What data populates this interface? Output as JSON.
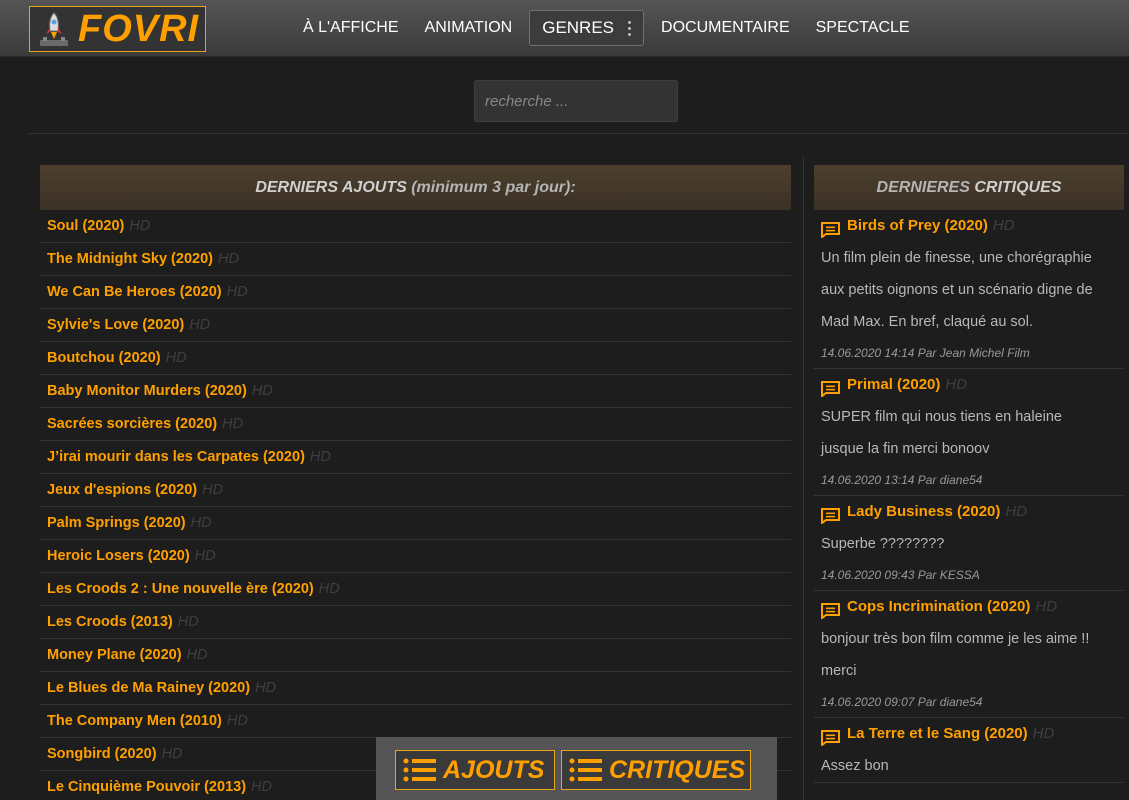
{
  "header": {
    "logo_text": "FOVRI",
    "nav": [
      {
        "label": "À L'AFFICHE"
      },
      {
        "label": "ANIMATION"
      },
      {
        "label": "GENRES"
      },
      {
        "label": "DOCUMENTAIRE"
      },
      {
        "label": "SPECTACLE"
      }
    ]
  },
  "search": {
    "placeholder": "recherche ..."
  },
  "latest": {
    "title_em": "DERNIERS AJOUTS",
    "title_rest": " (minimum 3 par jour):",
    "items": [
      {
        "title": "Soul (2020)",
        "quality": "HD"
      },
      {
        "title": "The Midnight Sky (2020)",
        "quality": "HD"
      },
      {
        "title": "We Can Be Heroes (2020)",
        "quality": "HD"
      },
      {
        "title": "Sylvie's Love (2020)",
        "quality": "HD"
      },
      {
        "title": "Boutchou (2020)",
        "quality": "HD"
      },
      {
        "title": "Baby Monitor Murders (2020)",
        "quality": "HD"
      },
      {
        "title": "Sacrées sorcières (2020)",
        "quality": "HD"
      },
      {
        "title": "J’irai mourir dans les Carpates (2020)",
        "quality": "HD"
      },
      {
        "title": "Jeux d'espions (2020)",
        "quality": "HD"
      },
      {
        "title": "Palm Springs (2020)",
        "quality": "HD"
      },
      {
        "title": "Heroic Losers (2020)",
        "quality": "HD"
      },
      {
        "title": "Les Croods 2 : Une nouvelle ère (2020)",
        "quality": "HD"
      },
      {
        "title": "Les Croods (2013)",
        "quality": "HD"
      },
      {
        "title": "Money Plane (2020)",
        "quality": "HD"
      },
      {
        "title": "Le Blues de Ma Rainey (2020)",
        "quality": "HD"
      },
      {
        "title": "The Company Men (2010)",
        "quality": "HD"
      },
      {
        "title": "Songbird (2020)",
        "quality": "HD"
      },
      {
        "title": "Le Cinquième Pouvoir (2013)",
        "quality": "HD"
      }
    ]
  },
  "reviews": {
    "title_a": "DERNIERES",
    "title_b": " CRITIQUES",
    "items": [
      {
        "title": "Birds of Prey (2020)",
        "quality": "HD",
        "lines": [
          "Un film plein de finesse, une chorégraphie",
          "aux petits oignons et un scénario digne de",
          "Mad Max. En bref, claqué au sol."
        ],
        "meta": "14.06.2020 14:14 Par Jean Michel Film"
      },
      {
        "title": "Primal (2020)",
        "quality": "HD",
        "lines": [
          "SUPER film qui nous tiens en haleine",
          "jusque la fin merci bonoov"
        ],
        "meta": "14.06.2020 13:14 Par diane54"
      },
      {
        "title": "Lady Business (2020)",
        "quality": "HD",
        "lines": [
          "Superbe ????????"
        ],
        "meta": "14.06.2020 09:43 Par KESSA"
      },
      {
        "title": "Cops Incrimination (2020)",
        "quality": "HD",
        "lines": [
          "bonjour très bon film comme je les aime !!",
          "merci"
        ],
        "meta": "14.06.2020 09:07 Par diane54"
      },
      {
        "title": "La Terre et le Sang (2020)",
        "quality": "HD",
        "lines": [
          "Assez bon"
        ],
        "meta": ""
      }
    ]
  },
  "bottom": {
    "ajouts_label": "AJOUTS",
    "critiques_label": "CRITIQUES"
  },
  "colors": {
    "accent": "#ffa000",
    "bg": "#1d1d1d",
    "panel_head": "#4c3f2e"
  },
  "icons": [
    "rocket-icon",
    "menu-dots-icon",
    "chat-icon",
    "list-icon"
  ]
}
